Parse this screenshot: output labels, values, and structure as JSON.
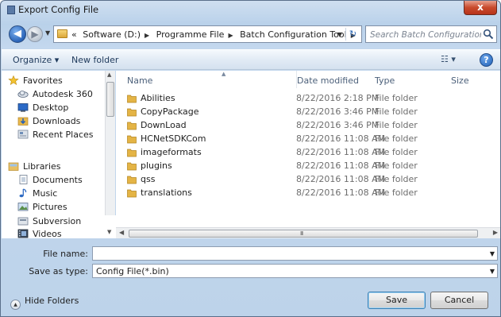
{
  "window": {
    "title": "Export Config File",
    "close_label": "x"
  },
  "address": {
    "crumbs": [
      "«",
      "Software (D:)",
      "Programme File",
      "Batch Configuration Tool"
    ],
    "search_placeholder": "Search Batch Configuration Tool"
  },
  "toolbar": {
    "organize": "Organize ▾",
    "new_folder": "New folder",
    "view": "☷ ▾",
    "help": "?"
  },
  "nav": {
    "favorites": "Favorites",
    "favorites_items": [
      "Autodesk 360",
      "Desktop",
      "Downloads",
      "Recent Places"
    ],
    "libraries": "Libraries",
    "libraries_items": [
      "Documents",
      "Music",
      "Pictures",
      "Subversion",
      "Videos"
    ]
  },
  "columns": {
    "name": "Name",
    "date": "Date modified",
    "type": "Type",
    "size": "Size"
  },
  "files": [
    {
      "name": "Abilities",
      "date": "8/22/2016 2:18 PM",
      "type": "File folder"
    },
    {
      "name": "CopyPackage",
      "date": "8/22/2016 3:46 PM",
      "type": "File folder"
    },
    {
      "name": "DownLoad",
      "date": "8/22/2016 3:46 PM",
      "type": "File folder"
    },
    {
      "name": "HCNetSDKCom",
      "date": "8/22/2016 11:08 AM",
      "type": "File folder"
    },
    {
      "name": "imageformats",
      "date": "8/22/2016 11:08 AM",
      "type": "File folder"
    },
    {
      "name": "plugins",
      "date": "8/22/2016 11:08 AM",
      "type": "File folder"
    },
    {
      "name": "qss",
      "date": "8/22/2016 11:08 AM",
      "type": "File folder"
    },
    {
      "name": "translations",
      "date": "8/22/2016 11:08 AM",
      "type": "File folder"
    }
  ],
  "form": {
    "file_name_label": "File name:",
    "file_name_value": "",
    "save_as_label": "Save as type:",
    "save_as_value": "Config File(*.bin)"
  },
  "footer": {
    "hide_folders": "Hide Folders",
    "save": "Save",
    "cancel": "Cancel"
  },
  "colors": {
    "accent": "#3c7fb1",
    "chrome": "#bdd3ea",
    "close": "#c84a2c",
    "folder": "#e4b445"
  }
}
